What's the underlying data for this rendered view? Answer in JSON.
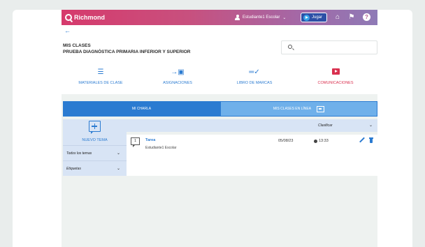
{
  "topbar": {
    "brand": "Richmond",
    "user_name": "Estudiante1 Escolar",
    "user_chevron": "⌄",
    "play_label": "Jugar",
    "help_glyph": "?"
  },
  "header": {
    "back_glyph": "←",
    "section_title": "MIS CLASES",
    "class_name": "PRUEBA DIAGNÓSTICA PRIMARIA INFERIOR Y SUPERIOR",
    "search_placeholder": ""
  },
  "nav": {
    "items": [
      {
        "label": "MATERIALES DE CLASE",
        "icon": "list-icon"
      },
      {
        "label": "ASIGNACIONES",
        "icon": "assignment-arrow-icon"
      },
      {
        "label": "LIBRO DE MARCAS",
        "icon": "gradebook-icon"
      },
      {
        "label": "COMUNICACIONES",
        "icon": "video-play-icon"
      }
    ]
  },
  "tabs": {
    "left": "MI CHARLA",
    "right": "MIS CLASES EN LÍNEA"
  },
  "sidebar": {
    "new_topic_label": "NUEVO TEMA",
    "filter_topics": "Todos los temas",
    "filter_labels": "Etiquetas",
    "caret": "⌄"
  },
  "sort": {
    "label": "Clasificar",
    "caret": "⌄"
  },
  "posts": [
    {
      "count": "1",
      "title": "Tarea",
      "author": "Estudiante1 Escolar",
      "date": "05/08/23",
      "time": "13:33"
    }
  ],
  "colors": {
    "accent_blue": "#2b7bd1",
    "communications_red": "#d9304f",
    "topbar_start": "#d63a6c",
    "topbar_end": "#8e7ab6"
  }
}
